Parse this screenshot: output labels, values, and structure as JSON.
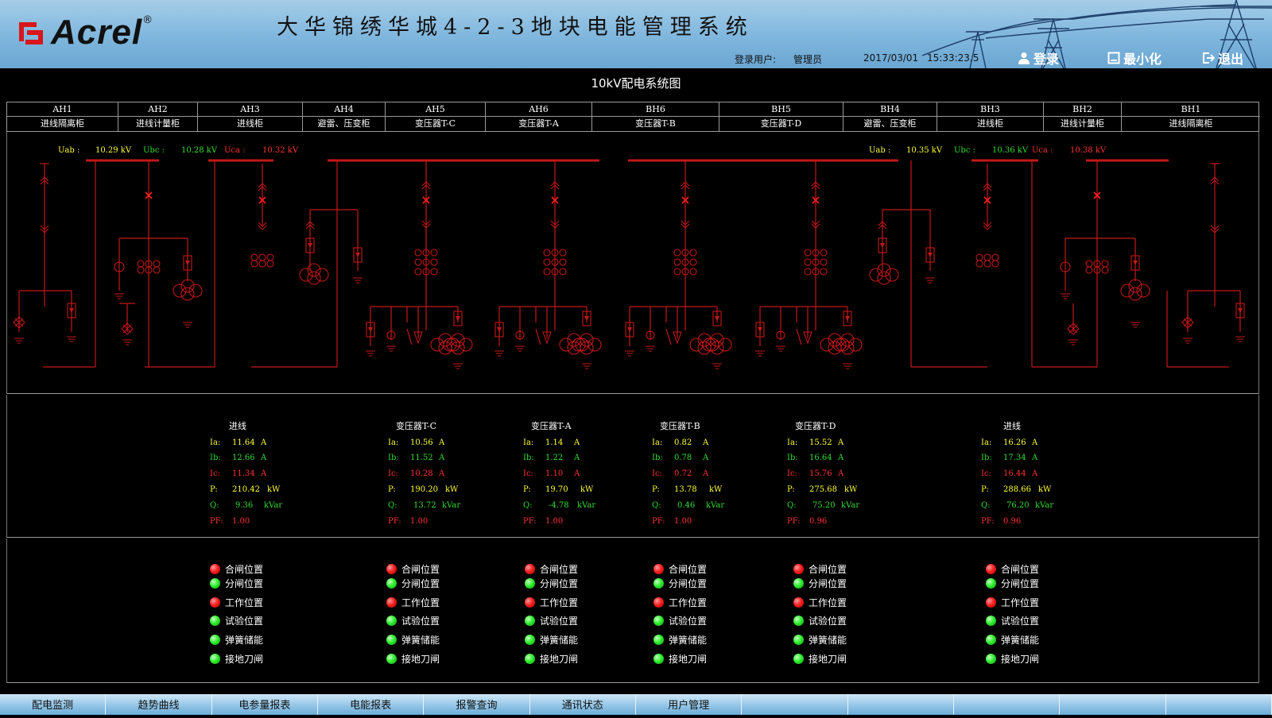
{
  "header": {
    "logo_text": "Acrel",
    "logo_reg": "®",
    "system_title": "大华锦绣华城4-2-3地块电能管理系统",
    "login_user_label": "登录用户:",
    "login_user_value": "管理员",
    "date": "2017/03/01",
    "time": "15:33:23.5",
    "login_btn": "登录",
    "minimize_btn": "最小化",
    "exit_btn": "退出"
  },
  "diagram_title": "10kV配电系统图",
  "cabinets": [
    {
      "id": "AH1",
      "name": "进线隔离柜"
    },
    {
      "id": "AH2",
      "name": "进线计量柜"
    },
    {
      "id": "AH3",
      "name": "进线柜"
    },
    {
      "id": "AH4",
      "name": "避雷、压变柜"
    },
    {
      "id": "AH5",
      "name": "变压器T-C"
    },
    {
      "id": "AH6",
      "name": "变压器T-A"
    },
    {
      "id": "BH6",
      "name": "变压器T-B"
    },
    {
      "id": "BH5",
      "name": "变压器T-D"
    },
    {
      "id": "BH4",
      "name": "避雷、压变柜"
    },
    {
      "id": "BH3",
      "name": "进线柜"
    },
    {
      "id": "BH2",
      "name": "进线计量柜"
    },
    {
      "id": "BH1",
      "name": "进线隔离柜"
    }
  ],
  "voltages_left": {
    "uab_label": "Uab :",
    "uab_value": "10.29 kV",
    "ubc_label": "Ubc :",
    "ubc_value": "10.28 kV",
    "uca_label": "Uca :",
    "uca_value": "10.32 kV"
  },
  "voltages_right": {
    "uab_label": "Uab :",
    "uab_value": "10.35 kV",
    "ubc_label": "Ubc :",
    "ubc_value": "10.36 kV",
    "uca_label": "Uca :",
    "uca_value": "10.38 kV"
  },
  "labels": {
    "ia": "Ia:",
    "ib": "Ib:",
    "ic": "Ic:",
    "p": "P:",
    "q": "Q:",
    "pf": "PF:",
    "unit_a": "A",
    "unit_kw": "kW",
    "unit_kvar": "kVar"
  },
  "measurements": [
    {
      "title": "进线",
      "ia": "11.64",
      "ib": "12.66",
      "ic": "11.34",
      "p": "210.42",
      "q": "9.36",
      "pf": "1.00"
    },
    {
      "title": "变压器T-C",
      "ia": "10.56",
      "ib": "11.52",
      "ic": "10.28",
      "p": "190.20",
      "q": "13.72",
      "pf": "1.00"
    },
    {
      "title": "变压器T-A",
      "ia": "1.14",
      "ib": "1.22",
      "ic": "1.10",
      "p": "19.70",
      "q": "-4.78",
      "pf": "1.00"
    },
    {
      "title": "变压器T-B",
      "ia": "0.82",
      "ib": "0.78",
      "ic": "0.72",
      "p": "13.78",
      "q": "0.46",
      "pf": "1.00"
    },
    {
      "title": "变压器T-D",
      "ia": "15.52",
      "ib": "16.64",
      "ic": "15.76",
      "p": "275.68",
      "q": "75.20",
      "pf": "0.96"
    },
    {
      "title": "进线",
      "ia": "16.26",
      "ib": "17.34",
      "ic": "16.44",
      "p": "288.66",
      "q": "76.20",
      "pf": "0.96"
    }
  ],
  "status_labels": [
    "合闸位置",
    "分闸位置",
    "工作位置",
    "试验位置",
    "弹簧储能",
    "接地刀闸"
  ],
  "status_colors": [
    "red",
    "green",
    "red",
    "green",
    "green",
    "green"
  ],
  "colors": {
    "red": "#ff2020",
    "green": "#2ef02e",
    "line": "#c41818",
    "voltage_yellow": "#ffff33",
    "voltage_green": "#33dd33",
    "voltage_red": "#ff3333"
  },
  "nav": [
    "配电监测",
    "趋势曲线",
    "电参量报表",
    "电能报表",
    "报警查询",
    "通讯状态",
    "用户管理",
    "",
    "",
    "",
    "",
    ""
  ]
}
